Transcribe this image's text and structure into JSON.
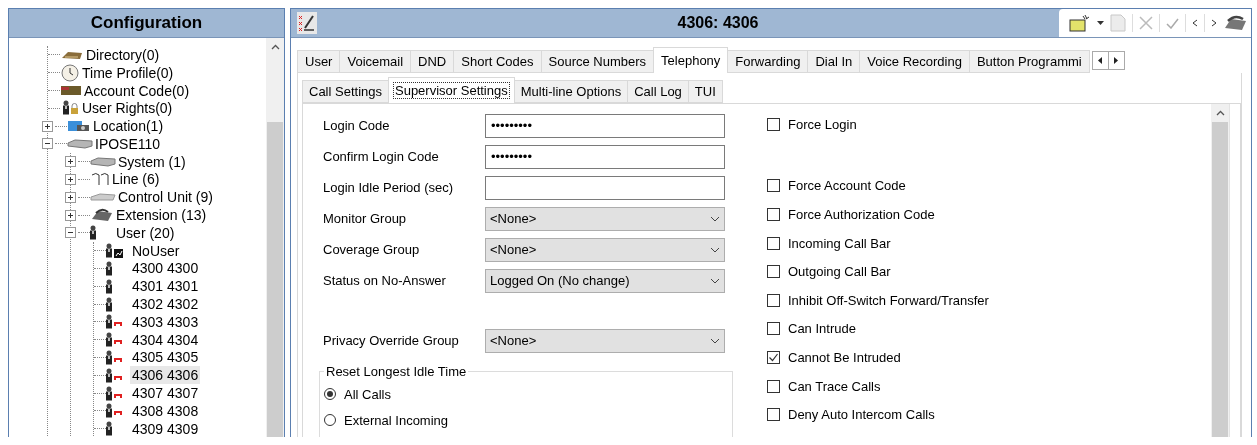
{
  "navigator": {
    "title": "Configuration",
    "tree": [
      {
        "label": "Directory(0)",
        "kind": "directory",
        "selected": false
      },
      {
        "label": "Time Profile(0)",
        "kind": "clock",
        "selected": false
      },
      {
        "label": "Account Code(0)",
        "kind": "account",
        "selected": false
      },
      {
        "label": "User Rights(0)",
        "kind": "rights",
        "selected": false
      },
      {
        "label": "Location(1)",
        "kind": "location",
        "selected": false,
        "expanded": false
      },
      {
        "label": "IPOSE110",
        "kind": "system",
        "selected": false,
        "expanded": true,
        "children": [
          {
            "label": "System (1)",
            "kind": "system",
            "selected": false,
            "expanded": false
          },
          {
            "label": "Line (6)",
            "kind": "line",
            "selected": false,
            "expanded": false
          },
          {
            "label": "Control Unit (9)",
            "kind": "unit",
            "selected": false,
            "expanded": false
          },
          {
            "label": "Extension (13)",
            "kind": "phone",
            "selected": false,
            "expanded": false
          },
          {
            "label": "User (20)",
            "kind": "user",
            "selected": false,
            "expanded": true,
            "children": [
              {
                "label": "NoUser",
                "kind": "nouser",
                "selected": false
              },
              {
                "label": "4300 4300",
                "kind": "user",
                "selected": false,
                "barred": false
              },
              {
                "label": "4301 4301",
                "kind": "user",
                "selected": false,
                "barred": false
              },
              {
                "label": "4302 4302",
                "kind": "user",
                "selected": false,
                "barred": false
              },
              {
                "label": "4303 4303",
                "kind": "user",
                "selected": false,
                "barred": true
              },
              {
                "label": "4304 4304",
                "kind": "user",
                "selected": false,
                "barred": true
              },
              {
                "label": "4305 4305",
                "kind": "user",
                "selected": false,
                "barred": true
              },
              {
                "label": "4306 4306",
                "kind": "user",
                "selected": true,
                "barred": true
              },
              {
                "label": "4307 4307",
                "kind": "user",
                "selected": false,
                "barred": true
              },
              {
                "label": "4308 4308",
                "kind": "user",
                "selected": false,
                "barred": true
              },
              {
                "label": "4309 4309",
                "kind": "user",
                "selected": false,
                "barred": false
              }
            ]
          }
        ]
      }
    ]
  },
  "editor": {
    "title": "4306: 4306",
    "tabs": [
      {
        "label": "User",
        "selected": false
      },
      {
        "label": "Voicemail",
        "selected": false
      },
      {
        "label": "DND",
        "selected": false
      },
      {
        "label": "Short Codes",
        "selected": false
      },
      {
        "label": "Source Numbers",
        "selected": false
      },
      {
        "label": "Telephony",
        "selected": true
      },
      {
        "label": "Forwarding",
        "selected": false
      },
      {
        "label": "Dial In",
        "selected": false
      },
      {
        "label": "Voice Recording",
        "selected": false
      },
      {
        "label": "Button Programmi",
        "selected": false
      }
    ],
    "subtabs": [
      {
        "label": "Call Settings",
        "selected": false
      },
      {
        "label": "Supervisor Settings",
        "selected": true
      },
      {
        "label": "Multi-line Options",
        "selected": false
      },
      {
        "label": "Call Log",
        "selected": false
      },
      {
        "label": "TUI",
        "selected": false
      }
    ],
    "fields": [
      {
        "label": "Login Code",
        "kind": "password",
        "value": "•••••••••"
      },
      {
        "label": "Confirm Login Code",
        "kind": "password",
        "value": "•••••••••"
      },
      {
        "label": "Login Idle Period (sec)",
        "kind": "text"
      },
      {
        "label": "Monitor Group",
        "kind": "select",
        "value": "<None>"
      },
      {
        "label": "Coverage Group",
        "kind": "select",
        "value": "<None>"
      },
      {
        "label": "Status on No-Answer",
        "kind": "select",
        "value": "Logged On (No change)"
      }
    ],
    "override_fields": [
      {
        "label": "Privacy Override Group",
        "kind": "select",
        "value": "<None>"
      }
    ],
    "reset_group": {
      "title": "Reset Longest Idle Time",
      "options": [
        {
          "label": "All Calls",
          "selected": true
        },
        {
          "label": "External Incoming",
          "selected": false
        }
      ]
    },
    "login_options": [
      {
        "label": "Force Login",
        "checked": false
      }
    ],
    "options": [
      {
        "label": "Force Account Code",
        "checked": false
      },
      {
        "label": "Force Authorization Code",
        "checked": false
      },
      {
        "label": "Incoming Call Bar",
        "checked": false
      },
      {
        "label": "Outgoing Call Bar",
        "checked": false
      },
      {
        "label": "Inhibit Off-Switch Forward/Transfer",
        "checked": false
      },
      {
        "label": "Can Intrude",
        "checked": false
      },
      {
        "label": "Cannot Be Intruded",
        "checked": true
      },
      {
        "label": "Can Trace Calls",
        "checked": false
      },
      {
        "label": "Deny Auto Intercom Calls",
        "checked": false
      }
    ]
  }
}
